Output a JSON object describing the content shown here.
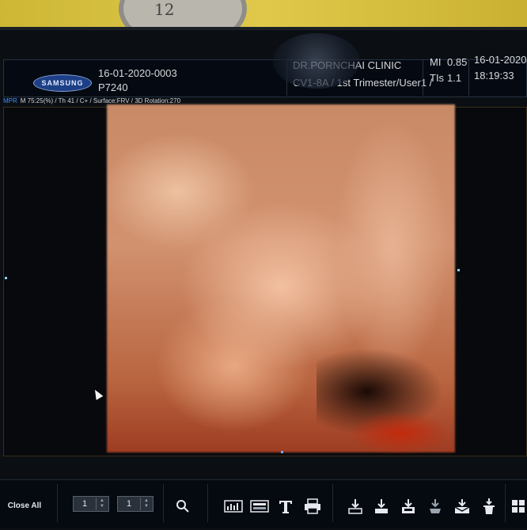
{
  "colors": {
    "accent_blue": "#3a8fff",
    "header_bg": "#050a12",
    "text": "#d6d8dc"
  },
  "header": {
    "brand": "SAMSUNG",
    "patient_id": "16-01-2020-0003",
    "probe_model": "P7240",
    "clinic": "DR.PORNCHAI CLINIC",
    "preset": "CV1-8A / 1st Trimester/User1 /",
    "mi_label": "MI",
    "mi_value": "0.85",
    "tis_label": "TIs",
    "tis_value": "1.1",
    "date": "16-01-2020",
    "time": "18:19:33"
  },
  "status": {
    "mode": "MPR",
    "params": "M 75:25(%) / Th 41 / C+ / Surface:FRV / 3D Rotation:270"
  },
  "toolbar": {
    "close_all_label": "Close All",
    "spinner1_value": "1",
    "spinner2_value": "1",
    "icons": [
      "search-icon",
      "histogram-icon",
      "layout-icon",
      "text-icon",
      "print-icon",
      "download-icon",
      "import-icon",
      "save-icon",
      "export-icon",
      "send-icon",
      "delete-icon",
      "grid-icon"
    ]
  },
  "clock_digits": "12"
}
